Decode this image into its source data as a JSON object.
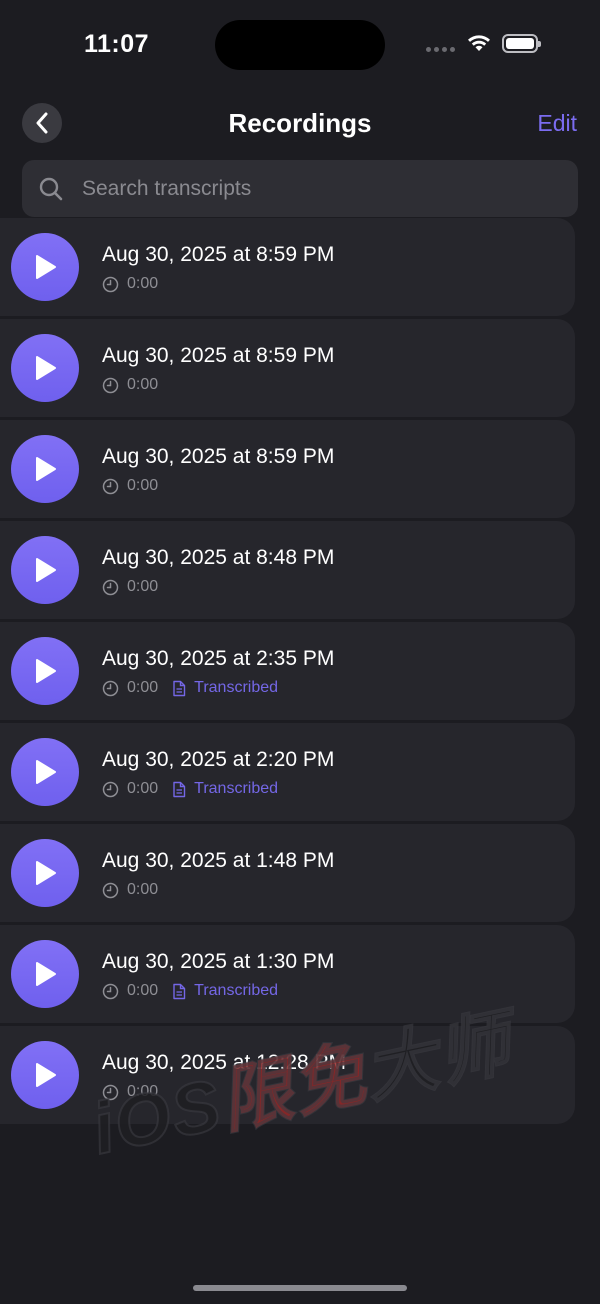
{
  "status_bar": {
    "time": "11:07"
  },
  "nav": {
    "title": "Recordings",
    "edit_label": "Edit"
  },
  "search": {
    "placeholder": "Search transcripts",
    "value": ""
  },
  "recordings": [
    {
      "title": "Aug 30, 2025 at 8:59 PM",
      "duration": "0:00",
      "status": ""
    },
    {
      "title": "Aug 30, 2025 at 8:59 PM",
      "duration": "0:00",
      "status": ""
    },
    {
      "title": "Aug 30, 2025 at 8:59 PM",
      "duration": "0:00",
      "status": ""
    },
    {
      "title": "Aug 30, 2025 at 8:48 PM",
      "duration": "0:00",
      "status": ""
    },
    {
      "title": "Aug 30, 2025 at 2:35 PM",
      "duration": "0:00",
      "status": "Transcribed"
    },
    {
      "title": "Aug 30, 2025 at 2:20 PM",
      "duration": "0:00",
      "status": "Transcribed"
    },
    {
      "title": "Aug 30, 2025 at 1:48 PM",
      "duration": "0:00",
      "status": ""
    },
    {
      "title": "Aug 30, 2025 at 1:30 PM",
      "duration": "0:00",
      "status": "Transcribed"
    },
    {
      "title": "Aug 30, 2025 at 12:28 PM",
      "duration": "0:00",
      "status": ""
    }
  ],
  "watermark": {
    "text_a": "iOS",
    "text_b": "限免",
    "text_c": "大师"
  },
  "colors": {
    "accent": "#7b6cf0",
    "background": "#1c1c21",
    "row_background": "#26262c"
  }
}
